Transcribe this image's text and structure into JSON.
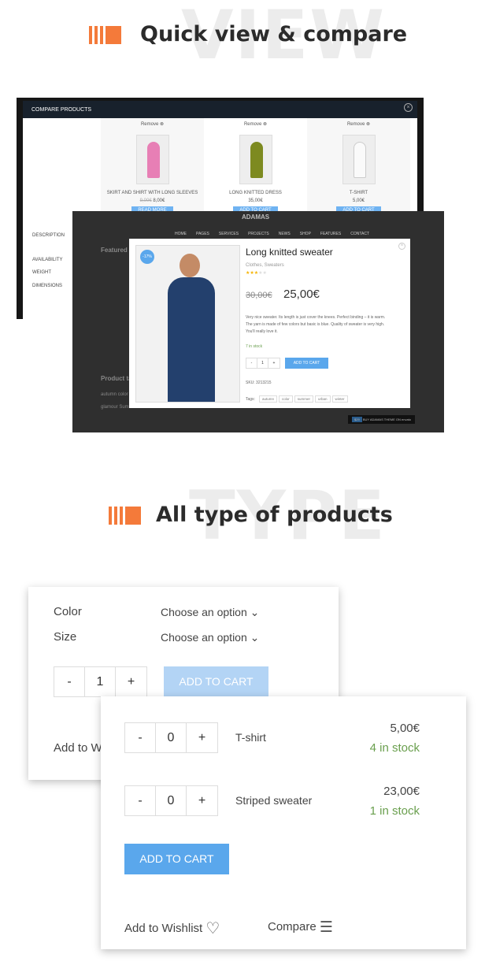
{
  "section1": {
    "watermark": "VIEW",
    "title": "Quick view & compare"
  },
  "compare": {
    "title": "COMPARE PRODUCTS",
    "remove": "Remove",
    "labels": [
      "DESCRIPTION",
      "AVAILABILITY",
      "WEIGHT",
      "DIMENSIONS"
    ],
    "products": [
      {
        "name": "SKIRT AND SHIRT WITH LONG SLEEVES",
        "old_price": "9,00€",
        "price": "8,00€",
        "button": "READ MORE",
        "color": "#e77fb5"
      },
      {
        "name": "LONG KNITTED DRESS",
        "old_price": "",
        "price": "35,00€",
        "button": "ADD TO CART",
        "color": "#7d8a20"
      },
      {
        "name": "T-SHIRT",
        "old_price": "",
        "price": "5,00€",
        "button": "ADD TO CART",
        "color": "#f0f0f0"
      }
    ]
  },
  "site": {
    "logo": "ADAMAS",
    "nav": [
      "HOME",
      "PAGES",
      "SERVICES",
      "PROJECTS",
      "NEWS",
      "SHOP",
      "FEATURES",
      "CONTACT"
    ],
    "featured": "Featured",
    "product_tags": "Product ta",
    "tags_text": "autumn color",
    "tags_text2": "glamour Summer urban",
    "buy_price": "$29",
    "buy_label": "BUY ADAMAS THEME ON envato"
  },
  "quickview": {
    "badge": "-17%",
    "title": "Long knitted sweater",
    "categories": "Clothes, Sweaters",
    "rating": 3,
    "rating_max": 5,
    "old_price": "30,00€",
    "price": "25,00€",
    "description": "Very nice sweater. Its length is just cover the knees. Perfect binding – it is warm. The yarn is made of few colors but basic is blue. Quality of sweater is very high. You'll really love it.",
    "stock": "7 in stock",
    "qty": "1",
    "add_to_cart": "ADD TO CART",
    "sku": "SKU: 3213215",
    "tags_label": "Tags:",
    "tags": [
      "autumn",
      "color",
      "summer",
      "urban",
      "winter"
    ]
  },
  "section2": {
    "watermark": "TYPE",
    "title": "All type of products"
  },
  "variable": {
    "color_label": "Color",
    "size_label": "Size",
    "select": "Choose an option",
    "qty": "1",
    "add_to_cart": "ADD TO CART",
    "wishlist": "Add to W"
  },
  "grouped": {
    "items": [
      {
        "name": "T-shirt",
        "qty": "0",
        "price": "5,00€",
        "stock": "4 in stock"
      },
      {
        "name": "Striped sweater",
        "qty": "0",
        "price": "23,00€",
        "stock": "1 in stock"
      }
    ],
    "add_to_cart": "ADD TO CART",
    "wishlist": "Add to Wishlist",
    "compare": "Compare"
  },
  "colors": {
    "accent": "#f47a3a",
    "button": "#5aa7ec",
    "button_disabled": "#b3d4f5",
    "stock": "#6a9f4e"
  }
}
